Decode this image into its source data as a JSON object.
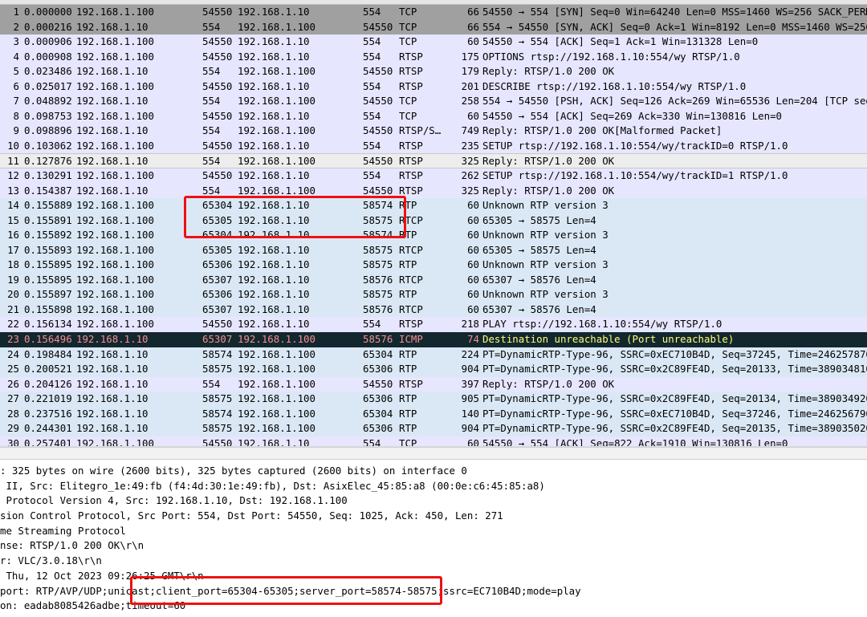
{
  "packets": [
    {
      "no": "1",
      "time": "0.000000",
      "src": "192.168.1.100",
      "sport": "54550",
      "dst": "192.168.1.10",
      "dport": "554",
      "proto": "TCP",
      "len": "66",
      "info": "54550 → 554 [SYN] Seq=0 Win=64240 Len=0 MSS=1460 WS=256 SACK_PERM",
      "style": "gray"
    },
    {
      "no": "2",
      "time": "0.000216",
      "src": "192.168.1.10",
      "sport": "554",
      "dst": "192.168.1.100",
      "dport": "54550",
      "proto": "TCP",
      "len": "66",
      "info": "554 → 54550 [SYN, ACK] Seq=0 Ack=1 Win=8192 Len=0 MSS=1460 WS=256",
      "style": "gray"
    },
    {
      "no": "3",
      "time": "0.000906",
      "src": "192.168.1.100",
      "sport": "54550",
      "dst": "192.168.1.10",
      "dport": "554",
      "proto": "TCP",
      "len": "60",
      "info": "54550 → 554 [ACK] Seq=1 Ack=1 Win=131328 Len=0",
      "style": "tcp"
    },
    {
      "no": "4",
      "time": "0.000908",
      "src": "192.168.1.100",
      "sport": "54550",
      "dst": "192.168.1.10",
      "dport": "554",
      "proto": "RTSP",
      "len": "175",
      "info": "OPTIONS rtsp://192.168.1.10:554/wy RTSP/1.0",
      "style": "tcp"
    },
    {
      "no": "5",
      "time": "0.023486",
      "src": "192.168.1.10",
      "sport": "554",
      "dst": "192.168.1.100",
      "dport": "54550",
      "proto": "RTSP",
      "len": "179",
      "info": "Reply: RTSP/1.0 200 OK",
      "style": "tcp"
    },
    {
      "no": "6",
      "time": "0.025017",
      "src": "192.168.1.100",
      "sport": "54550",
      "dst": "192.168.1.10",
      "dport": "554",
      "proto": "RTSP",
      "len": "201",
      "info": "DESCRIBE rtsp://192.168.1.10:554/wy RTSP/1.0",
      "style": "tcp"
    },
    {
      "no": "7",
      "time": "0.048892",
      "src": "192.168.1.10",
      "sport": "554",
      "dst": "192.168.1.100",
      "dport": "54550",
      "proto": "TCP",
      "len": "258",
      "info": "554 → 54550 [PSH, ACK] Seq=126 Ack=269 Win=65536 Len=204 [TCP segment",
      "style": "tcp"
    },
    {
      "no": "8",
      "time": "0.098753",
      "src": "192.168.1.100",
      "sport": "54550",
      "dst": "192.168.1.10",
      "dport": "554",
      "proto": "TCP",
      "len": "60",
      "info": "54550 → 554 [ACK] Seq=269 Ack=330 Win=130816 Len=0",
      "style": "tcp"
    },
    {
      "no": "9",
      "time": "0.098896",
      "src": "192.168.1.10",
      "sport": "554",
      "dst": "192.168.1.100",
      "dport": "54550",
      "proto": "RTSP/S…",
      "len": "749",
      "info": "Reply: RTSP/1.0 200 OK[Malformed Packet]",
      "style": "tcp"
    },
    {
      "no": "10",
      "time": "0.103062",
      "src": "192.168.1.100",
      "sport": "54550",
      "dst": "192.168.1.10",
      "dport": "554",
      "proto": "RTSP",
      "len": "235",
      "info": "SETUP rtsp://192.168.1.10:554/wy/trackID=0 RTSP/1.0",
      "style": "tcp"
    },
    {
      "no": "11",
      "time": "0.127876",
      "src": "192.168.1.10",
      "sport": "554",
      "dst": "192.168.1.100",
      "dport": "54550",
      "proto": "RTSP",
      "len": "325",
      "info": "Reply: RTSP/1.0 200 OK",
      "style": "selected"
    },
    {
      "no": "12",
      "time": "0.130291",
      "src": "192.168.1.100",
      "sport": "54550",
      "dst": "192.168.1.10",
      "dport": "554",
      "proto": "RTSP",
      "len": "262",
      "info": "SETUP rtsp://192.168.1.10:554/wy/trackID=1 RTSP/1.0",
      "style": "tcp"
    },
    {
      "no": "13",
      "time": "0.154387",
      "src": "192.168.1.10",
      "sport": "554",
      "dst": "192.168.1.100",
      "dport": "54550",
      "proto": "RTSP",
      "len": "325",
      "info": "Reply: RTSP/1.0 200 OK",
      "style": "tcp"
    },
    {
      "no": "14",
      "time": "0.155889",
      "src": "192.168.1.100",
      "sport": "65304",
      "dst": "192.168.1.10",
      "dport": "58574",
      "proto": "RTP",
      "len": "60",
      "info": "Unknown RTP version 3",
      "style": "blue"
    },
    {
      "no": "15",
      "time": "0.155891",
      "src": "192.168.1.100",
      "sport": "65305",
      "dst": "192.168.1.10",
      "dport": "58575",
      "proto": "RTCP",
      "len": "60",
      "info": "65305 → 58575 Len=4",
      "style": "blue"
    },
    {
      "no": "16",
      "time": "0.155892",
      "src": "192.168.1.100",
      "sport": "65304",
      "dst": "192.168.1.10",
      "dport": "58574",
      "proto": "RTP",
      "len": "60",
      "info": "Unknown RTP version 3",
      "style": "blue"
    },
    {
      "no": "17",
      "time": "0.155893",
      "src": "192.168.1.100",
      "sport": "65305",
      "dst": "192.168.1.10",
      "dport": "58575",
      "proto": "RTCP",
      "len": "60",
      "info": "65305 → 58575 Len=4",
      "style": "blue"
    },
    {
      "no": "18",
      "time": "0.155895",
      "src": "192.168.1.100",
      "sport": "65306",
      "dst": "192.168.1.10",
      "dport": "58575",
      "proto": "RTP",
      "len": "60",
      "info": "Unknown RTP version 3",
      "style": "blue"
    },
    {
      "no": "19",
      "time": "0.155895",
      "src": "192.168.1.100",
      "sport": "65307",
      "dst": "192.168.1.10",
      "dport": "58576",
      "proto": "RTCP",
      "len": "60",
      "info": "65307 → 58576 Len=4",
      "style": "blue"
    },
    {
      "no": "20",
      "time": "0.155897",
      "src": "192.168.1.100",
      "sport": "65306",
      "dst": "192.168.1.10",
      "dport": "58575",
      "proto": "RTP",
      "len": "60",
      "info": "Unknown RTP version 3",
      "style": "blue"
    },
    {
      "no": "21",
      "time": "0.155898",
      "src": "192.168.1.100",
      "sport": "65307",
      "dst": "192.168.1.10",
      "dport": "58576",
      "proto": "RTCP",
      "len": "60",
      "info": "65307 → 58576 Len=4",
      "style": "blue"
    },
    {
      "no": "22",
      "time": "0.156134",
      "src": "192.168.1.100",
      "sport": "54550",
      "dst": "192.168.1.10",
      "dport": "554",
      "proto": "RTSP",
      "len": "218",
      "info": "PLAY rtsp://192.168.1.10:554/wy RTSP/1.0",
      "style": "tcp"
    },
    {
      "no": "23",
      "time": "0.156496",
      "src": "192.168.1.10",
      "sport": "65307",
      "dst": "192.168.1.100",
      "dport": "58576",
      "proto": "ICMP",
      "len": "74",
      "info": "Destination unreachable (Port unreachable)",
      "style": "dark"
    },
    {
      "no": "24",
      "time": "0.198484",
      "src": "192.168.1.10",
      "sport": "58574",
      "dst": "192.168.1.100",
      "dport": "65304",
      "proto": "RTP",
      "len": "224",
      "info": "PT=DynamicRTP-Type-96, SSRC=0xEC710B4D, Seq=37245, Time=2462578701",
      "style": "blue"
    },
    {
      "no": "25",
      "time": "0.200521",
      "src": "192.168.1.10",
      "sport": "58575",
      "dst": "192.168.1.100",
      "dport": "65306",
      "proto": "RTP",
      "len": "904",
      "info": "PT=DynamicRTP-Type-96, SSRC=0x2C89FE4D, Seq=20133, Time=3890348100",
      "style": "blue"
    },
    {
      "no": "26",
      "time": "0.204126",
      "src": "192.168.1.10",
      "sport": "554",
      "dst": "192.168.1.100",
      "dport": "54550",
      "proto": "RTSP",
      "len": "397",
      "info": "Reply: RTSP/1.0 200 OK",
      "style": "tcp"
    },
    {
      "no": "27",
      "time": "0.221019",
      "src": "192.168.1.10",
      "sport": "58575",
      "dst": "192.168.1.100",
      "dport": "65306",
      "proto": "RTP",
      "len": "905",
      "info": "PT=DynamicRTP-Type-96, SSRC=0x2C89FE4D, Seq=20134, Time=3890349200",
      "style": "blue"
    },
    {
      "no": "28",
      "time": "0.237516",
      "src": "192.168.1.10",
      "sport": "58574",
      "dst": "192.168.1.100",
      "dport": "65304",
      "proto": "RTP",
      "len": "140",
      "info": "PT=DynamicRTP-Type-96, SSRC=0xEC710B4D, Seq=37246, Time=2462567900",
      "style": "blue"
    },
    {
      "no": "29",
      "time": "0.244301",
      "src": "192.168.1.10",
      "sport": "58575",
      "dst": "192.168.1.100",
      "dport": "65306",
      "proto": "RTP",
      "len": "904",
      "info": "PT=DynamicRTP-Type-96, SSRC=0x2C89FE4D, Seq=20135, Time=3890350200",
      "style": "blue"
    },
    {
      "no": "30",
      "time": "0.257401",
      "src": "192.168.1.100",
      "sport": "54550",
      "dst": "192.168.1.10",
      "dport": "554",
      "proto": "TCP",
      "len": "60",
      "info": "54550 → 554 [ACK] Seq=822 Ack=1910 Win=130816 Len=0",
      "style": "tcp"
    }
  ],
  "details": [
    {
      "text": ": 325 bytes on wire (2600 bits), 325 bytes captured (2600 bits) on interface 0"
    },
    {
      "text": " II, Src: Elitegro_1e:49:fb (f4:4d:30:1e:49:fb), Dst: AsixElec_45:85:a8 (00:0e:c6:45:85:a8)"
    },
    {
      "text": " Protocol Version 4, Src: 192.168.1.10, Dst: 192.168.1.100"
    },
    {
      "text": "sion Control Protocol, Src Port: 554, Dst Port: 54550, Seq: 1025, Ack: 450, Len: 271"
    },
    {
      "text": "me Streaming Protocol"
    },
    {
      "text": "nse: RTSP/1.0 200 OK\\r\\n"
    },
    {
      "text": "r: VLC/3.0.18\\r\\n"
    },
    {
      "text": " Thu, 12 Oct 2023 09:26:25 GMT\\r\\n"
    },
    {
      "text": "port: RTP/AVP/UDP;unicast;client_port=65304-65305;server_port=58574-58575;ssrc=EC710B4D;mode=play"
    },
    {
      "text": "on: eadab8085426adbe;timeout=60"
    }
  ]
}
